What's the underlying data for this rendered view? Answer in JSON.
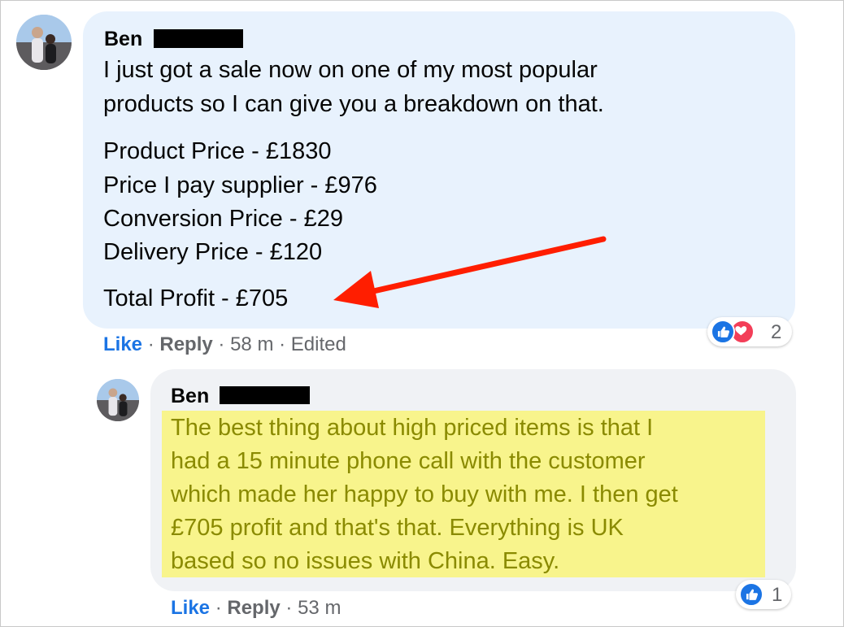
{
  "comment": {
    "author": "Ben",
    "intro_lines": [
      "I just got a sale now on one of my most popular",
      "products so I can give you a breakdown on that."
    ],
    "breakdown_lines": [
      "Product Price - £1830",
      "Price I pay supplier - £976",
      "Conversion Price - £29",
      "Delivery Price - £120"
    ],
    "total_line": "Total Profit - £705",
    "actions": {
      "like": "Like",
      "reply": "Reply",
      "time": "58 m",
      "edited": "Edited",
      "separator": "·"
    },
    "reactions": {
      "icons": [
        "like-icon",
        "love-icon"
      ],
      "count": "2"
    }
  },
  "reply": {
    "author": "Ben",
    "lines": [
      "The best thing about high priced items is that I",
      "had a 15 minute phone call with the customer",
      "which made her happy to buy with me. I then get",
      "£705 profit and that's that. Everything is UK",
      "based so no issues with China. Easy."
    ],
    "actions": {
      "like": "Like",
      "reply": "Reply",
      "time": "53 m",
      "separator": "·"
    },
    "reactions": {
      "icons": [
        "like-icon"
      ],
      "count": "1"
    }
  },
  "colors": {
    "like_blue": "#1b74e4",
    "highlight_yellow": "#f8f48c",
    "annotation_arrow": "#ff1e00",
    "love_red": "#f33e58"
  }
}
